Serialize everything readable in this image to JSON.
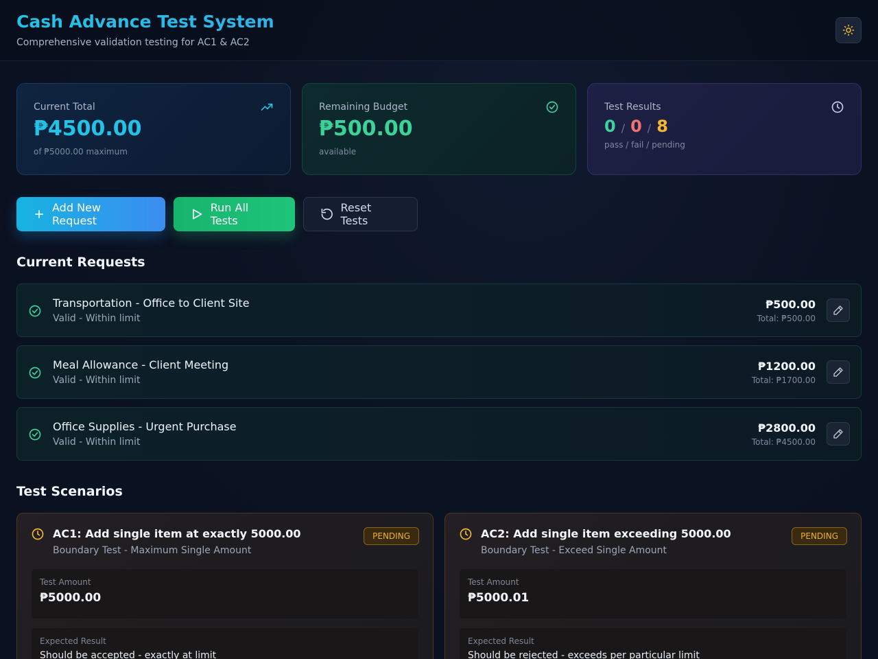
{
  "header": {
    "title": "Cash Advance Test System",
    "subtitle": "Comprehensive validation testing for AC1 & AC2",
    "theme_icon": "sun-icon"
  },
  "stats": {
    "current_total": {
      "label": "Current Total",
      "value": "₱4500.00",
      "sub": "of ₱5000.00 maximum",
      "icon": "trending-up-icon"
    },
    "remaining_budget": {
      "label": "Remaining Budget",
      "value": "₱500.00",
      "sub": "available",
      "icon": "check-circle-icon"
    },
    "test_results": {
      "label": "Test Results",
      "pass": "0",
      "fail": "0",
      "pending": "8",
      "sep1": "/",
      "sep2": "/",
      "sub": "pass / fail / pending",
      "icon": "clock-icon"
    }
  },
  "actions": {
    "add_label": "Add New Request",
    "run_label": "Run All Tests",
    "reset_label": "Reset Tests"
  },
  "requests": {
    "title": "Current Requests",
    "items": [
      {
        "name": "Transportation - Office to Client Site",
        "status": "Valid - Within limit",
        "amount": "₱500.00",
        "total": "Total: ₱500.00"
      },
      {
        "name": "Meal Allowance - Client Meeting",
        "status": "Valid - Within limit",
        "amount": "₱1200.00",
        "total": "Total: ₱1700.00"
      },
      {
        "name": "Office Supplies - Urgent Purchase",
        "status": "Valid - Within limit",
        "amount": "₱2800.00",
        "total": "Total: ₱4500.00"
      }
    ]
  },
  "scenarios": {
    "title": "Test Scenarios",
    "items": [
      {
        "title": "AC1: Add single item at exactly 5000.00",
        "desc": "Boundary Test - Maximum Single Amount",
        "badge": "PENDING",
        "amount_label": "Test Amount",
        "amount": "₱5000.00",
        "expected_label": "Expected Result",
        "expected": "Should be accepted - exactly at limit"
      },
      {
        "title": "AC2: Add single item exceeding 5000.00",
        "desc": "Boundary Test - Exceed Single Amount",
        "badge": "PENDING",
        "amount_label": "Test Amount",
        "amount": "₱5000.01",
        "expected_label": "Expected Result",
        "expected": "Should be rejected - exceeds per particular limit"
      }
    ]
  },
  "colors": {
    "accent_cyan": "#22c3e6",
    "success": "#3bd39a",
    "fail": "#f07272",
    "pending": "#f5b731"
  }
}
